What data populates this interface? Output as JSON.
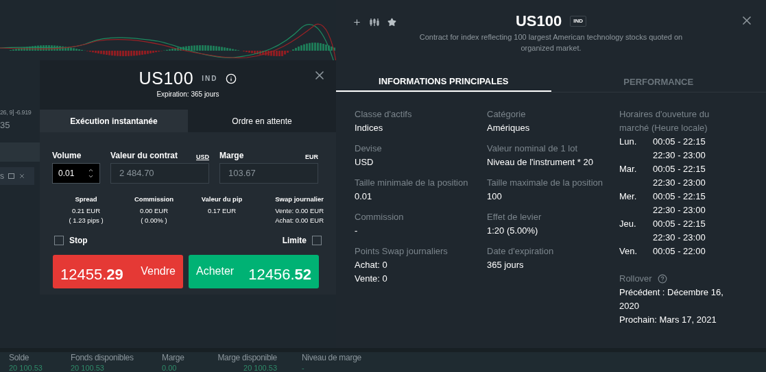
{
  "background_chart": {
    "legend_fragment": "26, 9] -6.919",
    "time_fragment": "35",
    "panel_tab_fragment": "s"
  },
  "order_ticket": {
    "symbol": "US100",
    "badge": "IND",
    "expiration": "Expiration: 365 jours",
    "tabs": [
      {
        "label": "Exécution instantanée",
        "selected": true
      },
      {
        "label": "Ordre en attente",
        "selected": false
      }
    ],
    "volume": {
      "label": "Volume",
      "value": "0.01"
    },
    "contract_value": {
      "label": "Valeur du contrat",
      "currency": "USD",
      "value": "2 484.70"
    },
    "margin": {
      "label": "Marge",
      "currency": "EUR",
      "value": "103.67"
    },
    "stats": [
      {
        "label": "Spread",
        "lines": [
          "0.21 EUR",
          "( 1.23 pips )"
        ]
      },
      {
        "label": "Commission",
        "lines": [
          "0.00 EUR",
          "( 0.00% )"
        ]
      },
      {
        "label": "Valeur du pip",
        "lines": [
          "0.17 EUR"
        ]
      },
      {
        "label": "Swap journalier",
        "lines": [
          "Vente: 0.00 EUR",
          "Achat: 0.00 EUR"
        ]
      }
    ],
    "options": [
      {
        "label": "Stop",
        "checked": false
      },
      {
        "label": "Limite",
        "checked": false
      }
    ],
    "sell": {
      "label": "Vendre",
      "price": "12455.",
      "price_pips": "29"
    },
    "buy": {
      "label": "Acheter",
      "price": "12456.",
      "price_pips": "52"
    }
  },
  "instrument_panel": {
    "symbol": "US100",
    "badge": "IND",
    "description": "Contract for index reflecting 100 largest American technology stocks quoted on organized market.",
    "tabs": [
      {
        "label": "INFORMATIONS PRINCIPALES",
        "selected": true
      },
      {
        "label": "PERFORMANCE",
        "selected": false
      }
    ],
    "columns": [
      [
        {
          "label": "Classe d'actifs",
          "values": [
            "Indices"
          ]
        },
        {
          "label": "Devise",
          "values": [
            "USD"
          ]
        },
        {
          "label": "Taille minimale de la position",
          "values": [
            "0.01"
          ]
        },
        {
          "label": "Commission",
          "values": [
            "-"
          ]
        },
        {
          "label": "Points Swap journaliers",
          "values": [
            "Achat: 0",
            "Vente: 0"
          ]
        }
      ],
      [
        {
          "label": "Catégorie",
          "values": [
            "Amériques"
          ]
        },
        {
          "label": "Valeur nominal de 1 lot",
          "values": [
            "Niveau de l'instrument * 20"
          ]
        },
        {
          "label": "Taille maximale de la position",
          "values": [
            "100"
          ]
        },
        {
          "label": "Effet de levier",
          "values": [
            "1:20 (5.00%)"
          ]
        },
        {
          "label": "Date d'expiration",
          "values": [
            "365 jours"
          ]
        }
      ]
    ],
    "hours_title": "Horaires d'ouveture du marché (Heure locale)",
    "schedule": [
      {
        "day": "Lun.",
        "ranges": [
          "00:05 - 22:15",
          "22:30 - 23:00"
        ]
      },
      {
        "day": "Mar.",
        "ranges": [
          "00:05 - 22:15",
          "22:30 - 23:00"
        ]
      },
      {
        "day": "Mer.",
        "ranges": [
          "00:05 - 22:15",
          "22:30 - 23:00"
        ]
      },
      {
        "day": "Jeu.",
        "ranges": [
          "00:05 - 22:15",
          "22:30 - 23:00"
        ]
      },
      {
        "day": "Ven.",
        "ranges": [
          "00:05 - 22:00"
        ]
      }
    ],
    "rollover": {
      "label": "Rollover",
      "lines": [
        "Précédent : Décembre 16, 2020",
        "Prochain: Mars 17, 2021"
      ]
    }
  },
  "account_bar": [
    {
      "label": "Solde",
      "value": "20 100.53"
    },
    {
      "label": "Fonds disponibles",
      "value": "20 100.53"
    },
    {
      "label": "Marge",
      "value": "0.00"
    },
    {
      "label": "Marge disponible",
      "value": "20 100.53"
    },
    {
      "label": "Niveau de marge",
      "value": "-"
    }
  ]
}
